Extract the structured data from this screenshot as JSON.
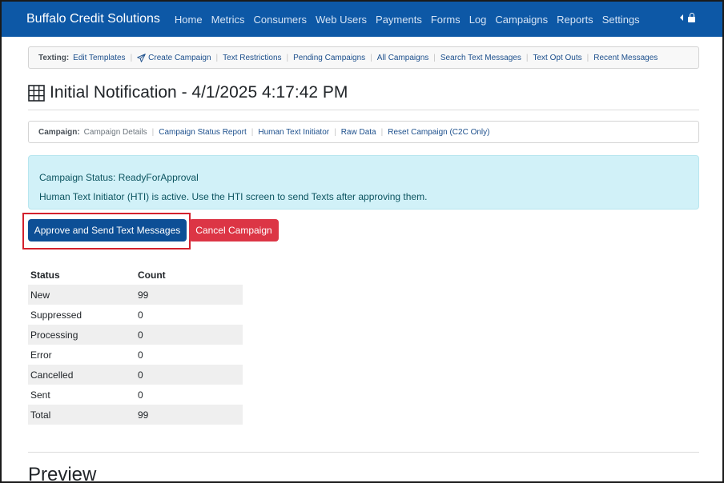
{
  "navbar": {
    "brand": "Buffalo Credit Solutions",
    "links": [
      "Home",
      "Metrics",
      "Consumers",
      "Web Users",
      "Payments",
      "Forms",
      "Log",
      "Campaigns",
      "Reports",
      "Settings"
    ],
    "bg_color": "#0d58a6"
  },
  "texting_nav": {
    "label": "Texting:",
    "links": [
      "Edit Templates",
      "Create Campaign",
      "Text Restrictions",
      "Pending Campaigns",
      "All Campaigns",
      "Search Text Messages",
      "Text Opt Outs",
      "Recent Messages"
    ]
  },
  "page": {
    "title": "Initial Notification - 4/1/2025 4:17:42 PM"
  },
  "campaign_nav": {
    "label": "Campaign:",
    "current": "Campaign Details",
    "links": [
      "Campaign Status Report",
      "Human Text Initiator",
      "Raw Data",
      "Reset Campaign (C2C Only)"
    ]
  },
  "alert": {
    "status_line": "Campaign Status: ReadyForApproval",
    "info_line": "Human Text Initiator (HTI) is active. Use the HTI screen to send Texts after approving them."
  },
  "actions": {
    "approve_label": "Approve and Send Text Messages",
    "cancel_label": "Cancel Campaign"
  },
  "status_table": {
    "headers": [
      "Status",
      "Count"
    ],
    "rows": [
      [
        "New",
        "99"
      ],
      [
        "Suppressed",
        "0"
      ],
      [
        "Processing",
        "0"
      ],
      [
        "Error",
        "0"
      ],
      [
        "Cancelled",
        "0"
      ],
      [
        "Sent",
        "0"
      ],
      [
        "Total",
        "99"
      ]
    ]
  },
  "preview": {
    "heading": "Preview"
  },
  "colors": {
    "primary": "#0d4f96",
    "danger": "#dc3545",
    "alert_bg": "#d1f1f8",
    "highlight": "#d3212d"
  }
}
